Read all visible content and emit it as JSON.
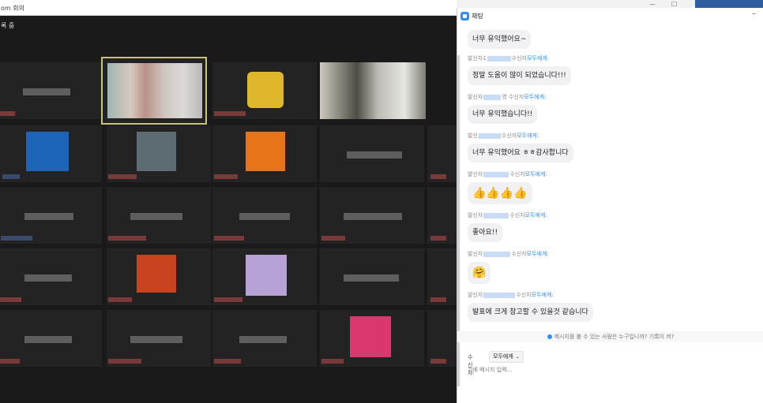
{
  "meeting": {
    "window_title": "om 회의",
    "recording_label": "록 중"
  },
  "chat": {
    "title": "채팅",
    "minimize": "–",
    "messages": [
      {
        "text": "너무 유익했어요~"
      },
      {
        "sender": "발신자1",
        "recipient_prefix": "수신자",
        "recipient": "모두에게:",
        "text": "정말 도움이 많이 되었습니다!!!"
      },
      {
        "sender": "발신자",
        "recipient_prefix": "영 수신자",
        "recipient": "모두에게:",
        "text": "너무 유익했습니다!!"
      },
      {
        "sender": "발신",
        "recipient_prefix": "수신자",
        "recipient": "모두에게:",
        "text": "너무 유익했어요 ㅎㅎ감사합니다"
      },
      {
        "sender": "발신자",
        "recipient_prefix": "수신자",
        "recipient": "모두에게:",
        "text": "👍👍👍👍"
      },
      {
        "sender": "발신자",
        "recipient_prefix": "수신자",
        "recipient": "모두에게:",
        "text": "좋아요!!"
      },
      {
        "sender": "발신자",
        "recipient_prefix": "수신자",
        "recipient": "모두에게:",
        "text": "🤗"
      },
      {
        "sender": "발신자",
        "recipient_prefix": "수신자",
        "recipient": "모두에게:",
        "text": "발표에 크게 참고할 수 있을것 같습니다"
      }
    ],
    "privacy_notice": "메시지를 볼 수 있는 사람은 누구입니까? 기록이 켜?",
    "to_label": "수신자:",
    "to_value": "모두에게",
    "input_placeholder": "기에 메시지 입력..."
  }
}
